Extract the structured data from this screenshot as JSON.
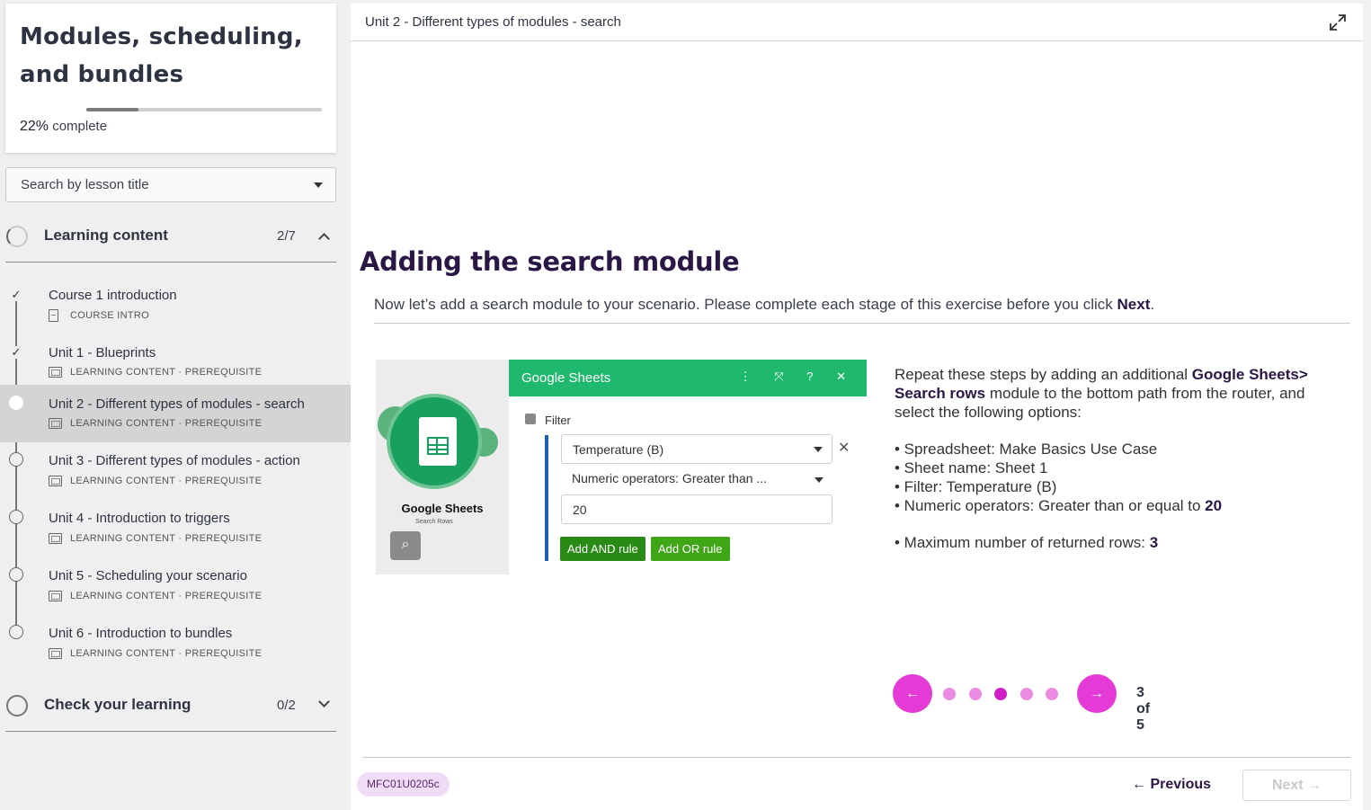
{
  "course": {
    "title": "Modules, scheduling, and bundles",
    "progress_percent": 22,
    "progress_number": "22%",
    "progress_word": " complete"
  },
  "search": {
    "placeholder": "Search by lesson title"
  },
  "sections": [
    {
      "label": "Learning content",
      "count": "2/7",
      "expanded": true
    },
    {
      "label": "Check your learning",
      "count": "0/2",
      "expanded": false
    }
  ],
  "lessons": [
    {
      "title": "Course 1 introduction",
      "meta": "COURSE INTRO",
      "status": "complete"
    },
    {
      "title": "Unit 1 - Blueprints",
      "meta": "LEARNING CONTENT · PREREQUISITE",
      "status": "complete"
    },
    {
      "title": "Unit 2 - Different types of modules - search",
      "meta": "LEARNING CONTENT · PREREQUISITE",
      "status": "active"
    },
    {
      "title": "Unit 3 - Different types of modules - action",
      "meta": "LEARNING CONTENT · PREREQUISITE",
      "status": "incomplete"
    },
    {
      "title": "Unit 4 - Introduction to triggers",
      "meta": "LEARNING CONTENT · PREREQUISITE",
      "status": "incomplete"
    },
    {
      "title": "Unit 5 - Scheduling your scenario",
      "meta": "LEARNING CONTENT · PREREQUISITE",
      "status": "incomplete"
    },
    {
      "title": "Unit 6 - Introduction to bundles",
      "meta": "LEARNING CONTENT · PREREQUISITE",
      "status": "incomplete"
    }
  ],
  "main": {
    "breadcrumb": "Unit 2 - Different types of modules - search",
    "heading": "Adding the search module",
    "intro_text": "Now let’s add a search module to your scenario. Please complete each stage of this exercise before you click ",
    "intro_bold": "Next",
    "intro_end": "."
  },
  "screenshot": {
    "app_name": "Google Sheets",
    "module_name": "Google Sheets",
    "module_sub": "Search Rows",
    "filter_label": "Filter",
    "field_column": "Temperature (B)",
    "field_operator": "Numeric operators: Greater than ...",
    "field_value": "20",
    "and_rule": "Add AND rule",
    "or_rule": "Add OR rule",
    "header_icons": "⋮ ⤧ ? ✕"
  },
  "steps": {
    "p1_a": "Repeat these steps by adding an additional ",
    "p1_bold": "Google Sheets> Search rows",
    "p1_b": " module to the bottom path from the router, and select the following options:",
    "b1": "• Spreadsheet: Make Basics Use Case",
    "b2": "• Sheet name: Sheet 1",
    "b3": "• Filter: Temperature (B)",
    "b4_a": "• Numeric operators: Greater than or equal to ",
    "b4_bold": "20",
    "b5_a": "• Maximum number of returned rows: ",
    "b5_bold": "3"
  },
  "carousel": {
    "current": 3,
    "total": 5,
    "label": "3 of 5"
  },
  "footer": {
    "code": "MFC01U0205c",
    "prev_label": "← Previous",
    "next_label": "Next →"
  },
  "colors": {
    "accent": "#e53bd6",
    "accent_active": "#cf1fc4",
    "heading": "#2a1745",
    "sheets_green": "#1fb96d"
  },
  "icons": {
    "expand": "expand-icon",
    "caret": "caret-down-icon",
    "arrow_left": "arrow-left-icon",
    "arrow_right": "arrow-right-icon",
    "zoom": "magnifier-icon"
  }
}
